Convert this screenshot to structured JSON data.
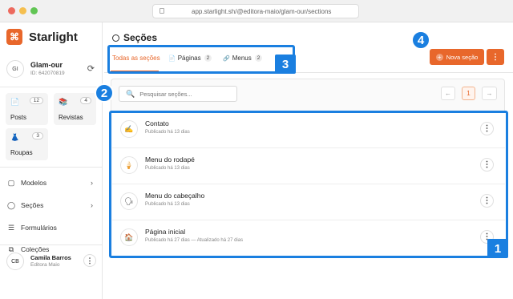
{
  "browser": {
    "url": "app.starlight.sh/@editora-maio/glam-our/sections"
  },
  "brand": {
    "logo_glyph": "⌘",
    "name": "Starlight"
  },
  "workspace": {
    "initials": "GI",
    "name": "Glam-our",
    "id": "ID: 642070819"
  },
  "tiles": [
    {
      "label": "Posts",
      "count": "12",
      "icon": "📄"
    },
    {
      "label": "Revistas",
      "count": "4",
      "icon": "📚"
    },
    {
      "label": "Roupas",
      "count": "3",
      "icon": "👗"
    }
  ],
  "nav": [
    {
      "label": "Modelos",
      "icon": "▢",
      "chevron": "›"
    },
    {
      "label": "Seções",
      "icon": "◯",
      "chevron": "›"
    },
    {
      "label": "Formulários",
      "icon": "☰"
    },
    {
      "label": "Coleções",
      "icon": "⧉"
    }
  ],
  "user": {
    "initials": "CB",
    "name": "Camila Barros",
    "org": "Editora Maio",
    "menu": "⋮"
  },
  "page": {
    "title": "Seções"
  },
  "tabs": [
    {
      "label": "Todas as seções"
    },
    {
      "label": "Páginas",
      "badge": "2",
      "icon": "📄"
    },
    {
      "label": "Menus",
      "badge": "2",
      "icon": "🔗"
    }
  ],
  "actions": {
    "new_section": "Nova seção",
    "new_icon": "+",
    "more": "⋮"
  },
  "search": {
    "placeholder": "Pesquisar seções...",
    "icon": "🔍"
  },
  "pager": {
    "prev": "←",
    "current": "1",
    "next": "→"
  },
  "sections": [
    {
      "title": "Contato",
      "subtitle": "Publicado há 13 dias",
      "icon": "✍"
    },
    {
      "title": "Menu do rodapé",
      "subtitle": "Publicado há 13 dias",
      "icon": "🍦"
    },
    {
      "title": "Menu do cabeçalho",
      "subtitle": "Publicado há 13 dias",
      "icon": "🗣"
    },
    {
      "title": "Página inicial",
      "subtitle": "Publicado há 27 dias — Atualizado há 27 dias",
      "icon": "🏠"
    }
  ],
  "annotations": {
    "one": "1",
    "two": "2",
    "three": "3",
    "four": "4"
  },
  "colors": {
    "accent": "#e8672b",
    "callout": "#1a7fe0"
  }
}
